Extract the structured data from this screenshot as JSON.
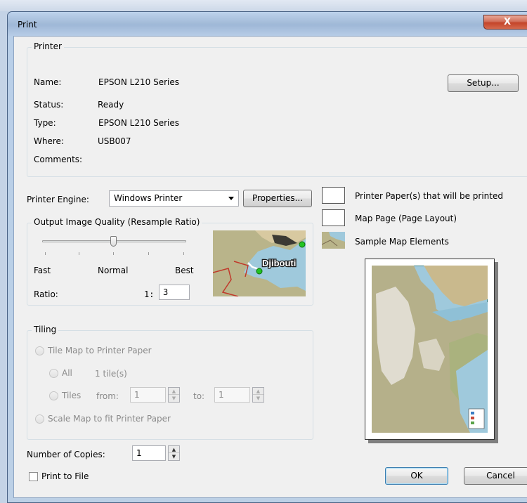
{
  "window": {
    "title": "Print",
    "close_glyph": "X"
  },
  "printer_group": {
    "label": "Printer",
    "name_label": "Name:",
    "name_value": "EPSON L210 Series",
    "status_label": "Status:",
    "status_value": "Ready",
    "type_label": "Type:",
    "type_value": "EPSON L210 Series",
    "where_label": "Where:",
    "where_value": "USB007",
    "comments_label": "Comments:",
    "comments_value": "",
    "setup_button": "Setup..."
  },
  "engine": {
    "label": "Printer Engine:",
    "selected": "Windows Printer",
    "properties_button": "Properties..."
  },
  "quality": {
    "label": "Output Image Quality (Resample Ratio)",
    "fast": "Fast",
    "normal": "Normal",
    "best": "Best",
    "ratio_label": "Ratio:",
    "ratio_prefix": "1:",
    "ratio_value": "3",
    "slider_level": "Normal",
    "preview_place_label": "Djibouti"
  },
  "tiling": {
    "label": "Tiling",
    "tile_map": "Tile Map to Printer Paper",
    "all": "All",
    "all_count": "1 tile(s)",
    "tiles": "Tiles",
    "from_label": "from:",
    "from_value": "1",
    "to_label": "to:",
    "to_value": "1",
    "scale_map": "Scale Map to fit Printer Paper"
  },
  "legend": {
    "printer_paper": "Printer Paper(s) that will be printed",
    "map_page": "Map Page (Page Layout)",
    "sample_elements": "Sample Map Elements"
  },
  "copies": {
    "label": "Number of Copies:",
    "value": "1"
  },
  "print_to_file": {
    "label": "Print to File",
    "checked": false
  },
  "buttons": {
    "ok": "OK",
    "cancel": "Cancel"
  },
  "colors": {
    "sea": "#9fc9dc",
    "land": "#b9b48a",
    "border_line": "#c0392b",
    "marker": "#22c322"
  }
}
